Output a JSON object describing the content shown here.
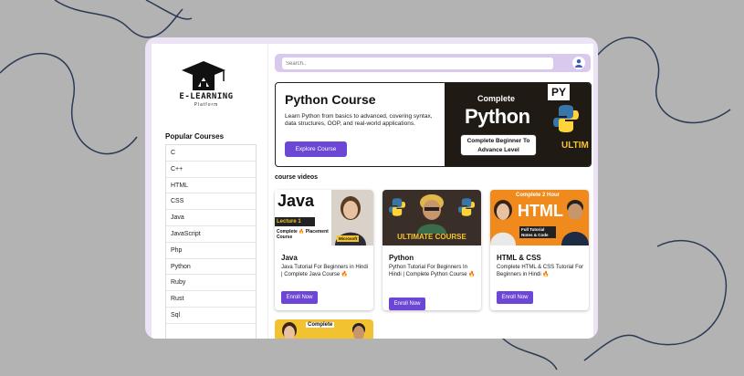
{
  "brand": {
    "logo_title": "E-LEARNING",
    "logo_subtitle": "Platform"
  },
  "sidebar": {
    "heading": "Popular Courses",
    "items": [
      "C",
      "C++",
      "HTML",
      "CSS",
      "Java",
      "JavaScript",
      "Php",
      "Python",
      "Ruby",
      "Rust",
      "Sql"
    ]
  },
  "search": {
    "placeholder": "Search..",
    "value": ""
  },
  "hero": {
    "title": "Python Course",
    "description": "Learn Python from basics to advanced, covering syntax, data structures, OOP, and real-world applications.",
    "button_label": "Explore Course",
    "image_text_top": "Complete",
    "image_text_main": "Python",
    "image_text_box": "Complete Beginner To Advance Level",
    "image_badge": "PY",
    "image_side": "ULTIM"
  },
  "section": {
    "title": "course videos"
  },
  "cards": [
    {
      "title": "Java",
      "description": "Java Tutorial For Beginners in Hindi | Complete Java Course 🔥",
      "button_label": "Enroll Now",
      "thumb_main": "Java",
      "thumb_sub": "Lecture 1",
      "thumb_caption": "Complete 🔥 Placement Course",
      "thumb_badge": "Microsoft"
    },
    {
      "title": "Python",
      "description": "Python Tutorial For Beginners In Hindi | Complete Python Course 🔥",
      "button_label": "Enroll Now",
      "thumb_main": "ULTIMATE COURSE"
    },
    {
      "title": "HTML & CSS",
      "description": "Complete HTML & CSS Tutorial For Beginners in Hindi 🔥",
      "button_label": "Enroll Now",
      "thumb_top": "Complete 2 Hour",
      "thumb_main": "HTML",
      "thumb_caption": "Full Tutorial Notes & Code"
    }
  ],
  "partial_card": {
    "thumb_top": "Complete"
  },
  "colors": {
    "accent": "#6c47d6",
    "frame": "#ede3f6",
    "search_bar": "#d9c9ee",
    "background": "#b3b3b3"
  }
}
